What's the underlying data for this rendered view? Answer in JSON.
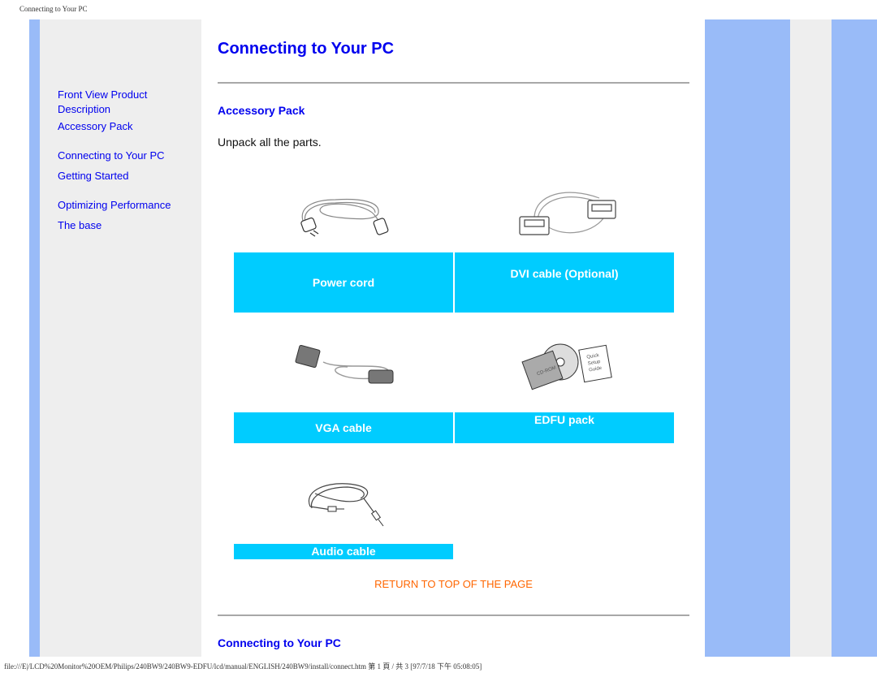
{
  "print_header": "Connecting to Your PC",
  "print_footer": "file:///E|/LCD%20Monitor%20OEM/Philips/240BW9/240BW9-EDFU/lcd/manual/ENGLISH/240BW9/install/connect.htm 第 1 頁 / 共 3 [97/7/18 下午 05:08:05]",
  "sidebar": {
    "items": [
      {
        "label": "Front View Product Description"
      },
      {
        "label": "Accessory Pack"
      },
      {
        "label": "Connecting to Your PC"
      },
      {
        "label": "Getting Started"
      },
      {
        "label": "Optimizing Performance"
      },
      {
        "label": "The base"
      }
    ]
  },
  "main": {
    "title": "Connecting to Your PC",
    "accessory_section": {
      "heading": "Accessory Pack",
      "intro": "Unpack all the parts.",
      "items": [
        {
          "label": "Power cord",
          "icon": "power-cord-icon"
        },
        {
          "label": "DVI cable (Optional)",
          "icon": "dvi-cable-icon"
        },
        {
          "label": "VGA cable",
          "icon": "vga-cable-icon"
        },
        {
          "label": "EDFU pack",
          "icon": "edfu-pack-icon"
        },
        {
          "label": "Audio cable",
          "icon": "audio-cable-icon"
        }
      ]
    },
    "return_link": "RETURN TO TOP OF THE PAGE",
    "connect_section": {
      "heading": "Connecting to Your PC"
    }
  },
  "colors": {
    "link": "#0000ee",
    "label_bg": "#00ccff",
    "return_link": "#ff6600",
    "stripe": "#99bbf8",
    "panel": "#eeeeee"
  }
}
